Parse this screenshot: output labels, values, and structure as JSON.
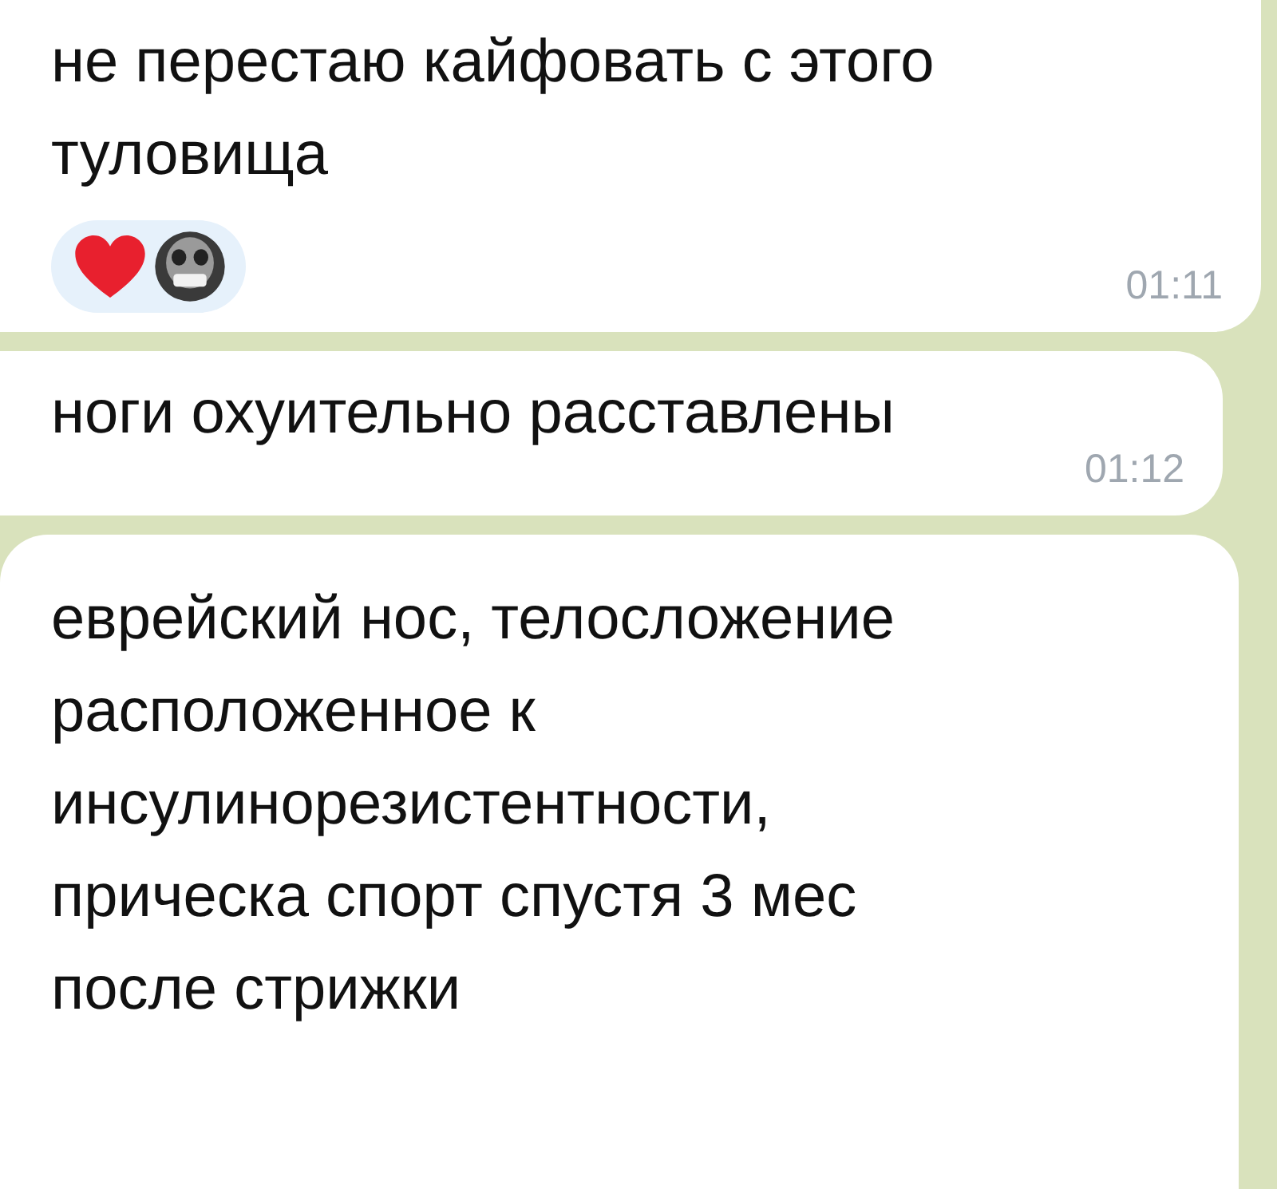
{
  "messages": [
    {
      "text": "не перестаю кайфовать с этого\nтуловища",
      "time": "01:11",
      "reactions": [
        {
          "kind": "heart"
        },
        {
          "kind": "skull"
        }
      ]
    },
    {
      "text": "ноги охуительно расставлены",
      "time": "01:12"
    },
    {
      "text": "еврейский нос, телосложение\nрасположенное к\nинсулинорезистентности,\nприческа спорт спустя 3 мес\nпосле стрижки"
    }
  ]
}
